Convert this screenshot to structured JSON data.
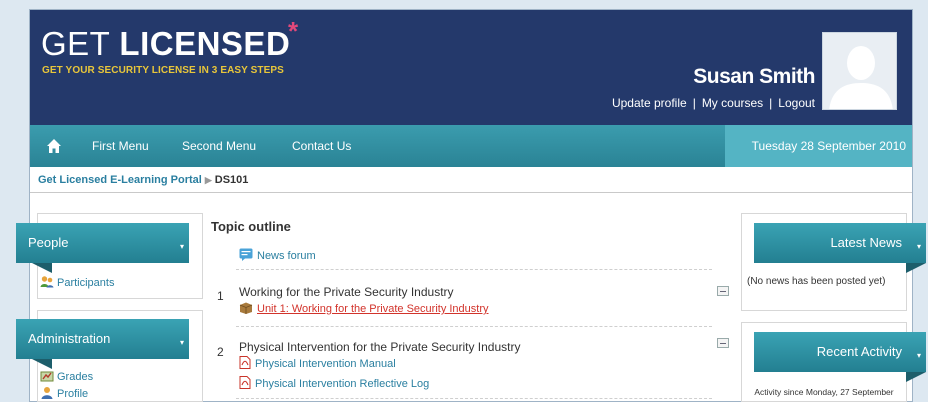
{
  "header": {
    "logo_light": "GET ",
    "logo_bold": "LICENSED",
    "logo_star": "*",
    "tagline": "GET YOUR SECURITY LICENSE IN 3 EASY STEPS",
    "user_name": "Susan Smith",
    "links": {
      "update_profile": "Update profile",
      "my_courses": "My courses",
      "logout": "Logout",
      "separator": "|"
    }
  },
  "nav": {
    "items": [
      "First Menu",
      "Second Menu",
      "Contact Us"
    ],
    "date": "Tuesday 28 September 2010"
  },
  "breadcrumb": {
    "root": "Get Licensed E-Learning Portal",
    "current": "DS101"
  },
  "left_blocks": {
    "people": {
      "title": "People",
      "links": [
        "Participants"
      ]
    },
    "administration": {
      "title": "Administration",
      "links": [
        "Grades",
        "Profile"
      ]
    }
  },
  "main": {
    "title": "Topic outline",
    "forum": "News forum",
    "sections": [
      {
        "num": "1",
        "title": "Working for the Private Security Industry",
        "resources": [
          "Unit 1: Working for the Private Security Industry"
        ]
      },
      {
        "num": "2",
        "title": "Physical Intervention for the Private Security Industry",
        "resources": [
          "Physical Intervention Manual",
          "Physical Intervention Reflective Log"
        ]
      }
    ]
  },
  "right_blocks": {
    "latest_news": {
      "title": "Latest News",
      "text": "(No news has been posted yet)"
    },
    "recent_activity": {
      "title": "Recent Activity",
      "text": "Activity since Monday, 27 September"
    }
  },
  "colors": {
    "header_bg": "#24396b",
    "nav_bg": "#2a8395",
    "date_bg": "#54b4c4",
    "tagline": "#e8c63a",
    "star": "#e3497b",
    "link": "#2a7fa0",
    "active_link": "#d2332b"
  }
}
